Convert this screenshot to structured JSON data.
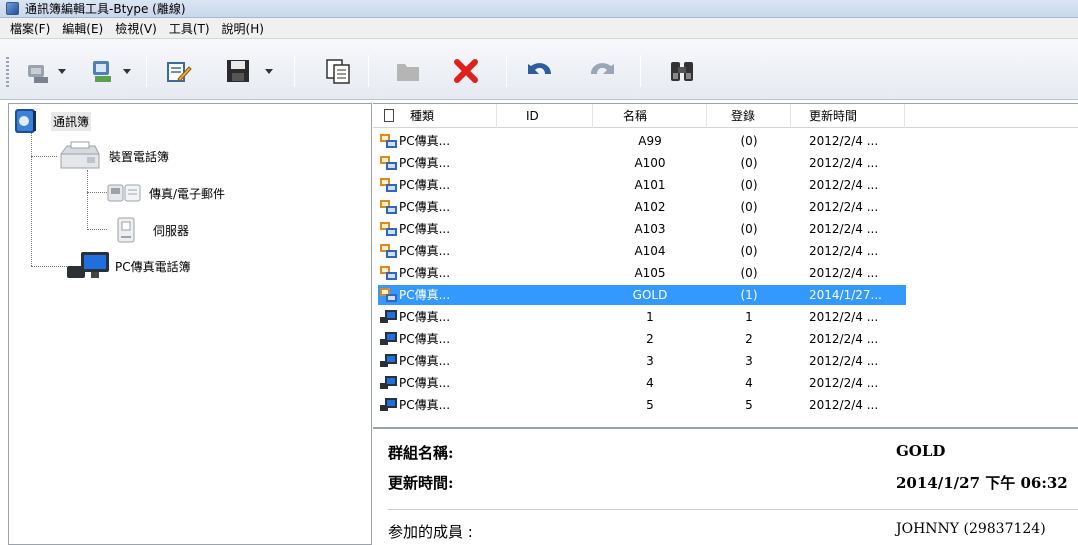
{
  "window": {
    "title": "通訊簿編輯工具-Btype (離線)"
  },
  "menu": [
    "檔案(F)",
    "編輯(E)",
    "檢視(V)",
    "工具(T)",
    "說明(H)"
  ],
  "toolbar": {
    "buttons": [
      {
        "icon": "group-add-icon",
        "dropdown": true
      },
      {
        "icon": "group-new-icon",
        "dropdown": true
      },
      {
        "icon": "edit-icon",
        "dropdown": false
      },
      {
        "icon": "save-icon",
        "dropdown": true
      },
      {
        "icon": "copy-icon",
        "dropdown": false
      },
      {
        "icon": "folder-icon",
        "dropdown": false
      },
      {
        "icon": "delete-icon",
        "dropdown": false
      },
      {
        "icon": "undo-icon",
        "dropdown": false
      },
      {
        "icon": "redo-icon",
        "dropdown": false
      },
      {
        "icon": "find-icon",
        "dropdown": false
      }
    ]
  },
  "tree": {
    "root": "通訊簿",
    "device_book": "裝置電話簿",
    "fax_email": "傳真/電子郵件",
    "server": "伺服器",
    "pc_fax_book": "PC傳真電話簿"
  },
  "list": {
    "columns": [
      "種類",
      "ID",
      "名稱",
      "登錄",
      "更新時間"
    ],
    "rows": [
      {
        "type": "PC傳真...",
        "id": "",
        "name": "A99",
        "entries": "(0)",
        "updated": "2012/2/4 ...",
        "kind": "group"
      },
      {
        "type": "PC傳真...",
        "id": "",
        "name": "A100",
        "entries": "(0)",
        "updated": "2012/2/4 ...",
        "kind": "group"
      },
      {
        "type": "PC傳真...",
        "id": "",
        "name": "A101",
        "entries": "(0)",
        "updated": "2012/2/4 ...",
        "kind": "group"
      },
      {
        "type": "PC傳真...",
        "id": "",
        "name": "A102",
        "entries": "(0)",
        "updated": "2012/2/4 ...",
        "kind": "group"
      },
      {
        "type": "PC傳真...",
        "id": "",
        "name": "A103",
        "entries": "(0)",
        "updated": "2012/2/4 ...",
        "kind": "group"
      },
      {
        "type": "PC傳真...",
        "id": "",
        "name": "A104",
        "entries": "(0)",
        "updated": "2012/2/4 ...",
        "kind": "group"
      },
      {
        "type": "PC傳真...",
        "id": "",
        "name": "A105",
        "entries": "(0)",
        "updated": "2012/2/4 ...",
        "kind": "group"
      },
      {
        "type": "PC傳真...",
        "id": "",
        "name": "GOLD",
        "entries": "(1)",
        "updated": "2014/1/27...",
        "kind": "group",
        "selected": true
      },
      {
        "type": "PC傳真...",
        "id": "",
        "name": "1",
        "entries": "1",
        "updated": "2012/2/4 ...",
        "kind": "contact"
      },
      {
        "type": "PC傳真...",
        "id": "",
        "name": "2",
        "entries": "2",
        "updated": "2012/2/4 ...",
        "kind": "contact"
      },
      {
        "type": "PC傳真...",
        "id": "",
        "name": "3",
        "entries": "3",
        "updated": "2012/2/4 ...",
        "kind": "contact"
      },
      {
        "type": "PC傳真...",
        "id": "",
        "name": "4",
        "entries": "4",
        "updated": "2012/2/4 ...",
        "kind": "contact"
      },
      {
        "type": "PC傳真...",
        "id": "",
        "name": "5",
        "entries": "5",
        "updated": "2012/2/4 ...",
        "kind": "contact"
      }
    ]
  },
  "details": {
    "group_name_label": "群組名稱:",
    "group_name_value": "GOLD",
    "updated_label": "更新時間:",
    "updated_value": "2014/1/27 下午 06:32",
    "members_label": "参加的成員 :",
    "members_value": "JOHNNY (29837124)"
  },
  "colors": {
    "selection": "#3399ff",
    "window_bg": "#f0f0f0"
  }
}
